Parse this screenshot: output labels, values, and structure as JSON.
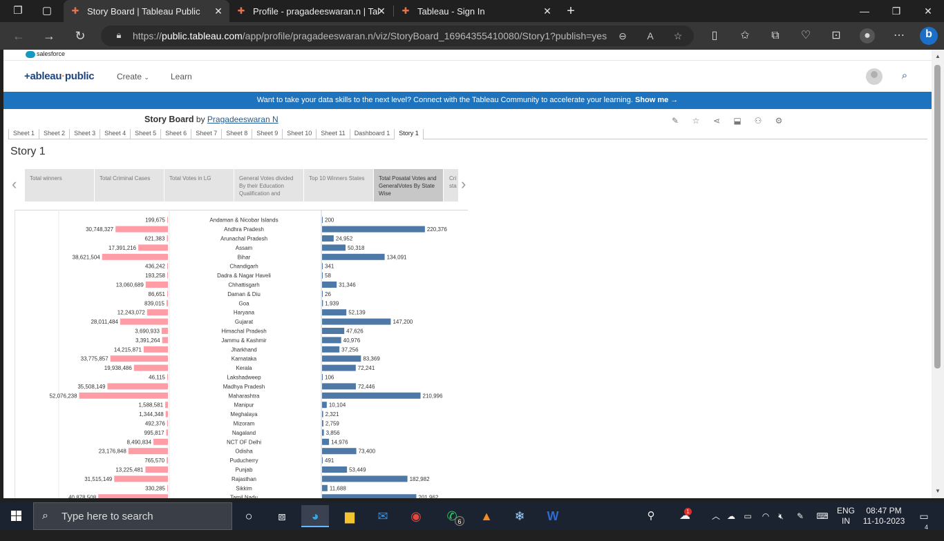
{
  "browser": {
    "tabs": [
      {
        "title": "Story Board | Tableau Public",
        "active": true
      },
      {
        "title": "Profile - pragadeeswaran.n | Tabl",
        "active": false
      },
      {
        "title": "Tableau - Sign In",
        "active": false
      }
    ],
    "url_prefix": "https://",
    "url_host": "public.tableau.com",
    "url_path": "/app/profile/pragadeeswaran.n/viz/StoryBoard_16964355410080/Story1?publish=yes"
  },
  "page": {
    "salesforce_label": "salesforce",
    "logo_main": "+ableau",
    "logo_accent": "public",
    "nav_create": "Create",
    "nav_learn": "Learn",
    "banner_text": "Want to take your data skills to the next level? Connect with the Tableau Community to accelerate your learning.",
    "banner_link": "Show me →",
    "viz_title": "Story Board",
    "viz_by": "by",
    "viz_author": "Pragadeeswaran N",
    "sheet_tabs": [
      "Sheet 1",
      "Sheet 2",
      "Sheet 3",
      "Sheet 4",
      "Sheet 5",
      "Sheet 6",
      "Sheet 7",
      "Sheet 8",
      "Sheet 9",
      "Sheet 10",
      "Sheet 11",
      "Dashboard 1",
      "Story 1"
    ],
    "active_sheet": "Story 1",
    "story_title": "Story 1",
    "story_points": [
      "Total winners",
      "Total Criminal Cases",
      "Total Votes in LG",
      "General Votes divided By their Education Qualification and",
      "Top 10 Winners States",
      "Total Posatal Votes and GeneralVotes By State Wise",
      "Cri sta"
    ],
    "active_story_point": 5
  },
  "chart_data": {
    "type": "bar",
    "title": "",
    "categories": [
      "Andaman & Nicobar Islands",
      "Andhra Pradesh",
      "Arunachal Pradesh",
      "Assam",
      "Bihar",
      "Chandigarh",
      "Dadra & Nagar Haveli",
      "Chhattisgarh",
      "Daman & Diu",
      "Goa",
      "Haryana",
      "Gujarat",
      "Himachal Pradesh",
      "Jammu & Kashmir",
      "Jharkhand",
      "Karnataka",
      "Kerala",
      "Lakshadweep",
      "Madhya Pradesh",
      "Maharashtra",
      "Manipur",
      "Meghalaya",
      "Mizoram",
      "Nagaland",
      "NCT OF Delhi",
      "Odisha",
      "Puducherry",
      "Punjab",
      "Rajasthan",
      "Sikkim",
      "Tamil Nadu"
    ],
    "series": [
      {
        "values": [
          199675,
          30748327,
          621383,
          17391216,
          38621504,
          436242,
          193258,
          13060689,
          86651,
          839015,
          12243072,
          28011484,
          3690933,
          3391264,
          14215871,
          33775857,
          19938486,
          46115,
          35508149,
          52076238,
          1588581,
          1344348,
          492376,
          995817,
          8490834,
          23176848,
          765570,
          13225481,
          31515149,
          330285,
          40878508
        ],
        "color": "#ff9da7"
      },
      {
        "values": [
          200,
          220376,
          24952,
          50318,
          134091,
          341,
          58,
          31346,
          26,
          1939,
          52139,
          147200,
          47626,
          40976,
          37256,
          83369,
          72241,
          106,
          72446,
          210996,
          10104,
          2321,
          2759,
          3856,
          14976,
          73400,
          491,
          53449,
          182982,
          11688,
          201962
        ],
        "color": "#4e79a7"
      }
    ]
  },
  "taskbar": {
    "search_placeholder": "Type here to search",
    "whatsapp_badge": "6",
    "lang_top": "ENG",
    "lang_bottom": "IN",
    "time": "08:47 PM",
    "date": "11-10-2023",
    "notifications": "4",
    "weather_badge": "1"
  }
}
